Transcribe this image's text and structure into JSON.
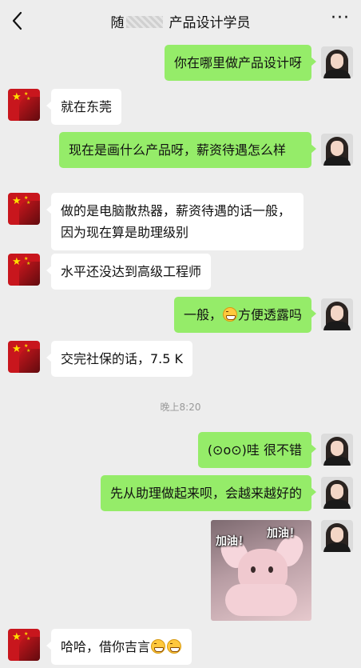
{
  "header": {
    "title_prefix": "随",
    "title_main": "产品设计学员",
    "more_label": "···"
  },
  "messages": [
    {
      "side": "me",
      "text": "你在哪里做产品设计呀"
    },
    {
      "side": "them",
      "text": "就在东莞"
    },
    {
      "side": "me",
      "text": "现在是画什么产品呀，薪资待遇怎么样"
    },
    {
      "side": "them",
      "text": "做的是电脑散热器，薪资待遇的话一般，因为现在算是助理级别"
    },
    {
      "side": "them",
      "text": "水平还没达到高级工程师"
    },
    {
      "side": "me",
      "text_before": "一般，",
      "text_after": "方便透露吗"
    },
    {
      "side": "them",
      "text": "交完社保的话，7.5 K"
    },
    {
      "side": "me",
      "text": "(⊙o⊙)哇 很不错"
    },
    {
      "side": "me",
      "text": "先从助理做起来呗，会越来越好的"
    },
    {
      "side": "them",
      "text": "哈哈，借你吉言"
    }
  ],
  "timestamp": "晚上8:20",
  "sticker": {
    "caption_left": "加油！",
    "caption_right": "加油！"
  },
  "icons": {
    "back": "chevron-left-icon",
    "more": "more-dots-icon",
    "emoji": "grin-emoji-icon"
  },
  "colors": {
    "background": "#ededed",
    "my_bubble": "#95ec69",
    "their_bubble": "#ffffff"
  }
}
